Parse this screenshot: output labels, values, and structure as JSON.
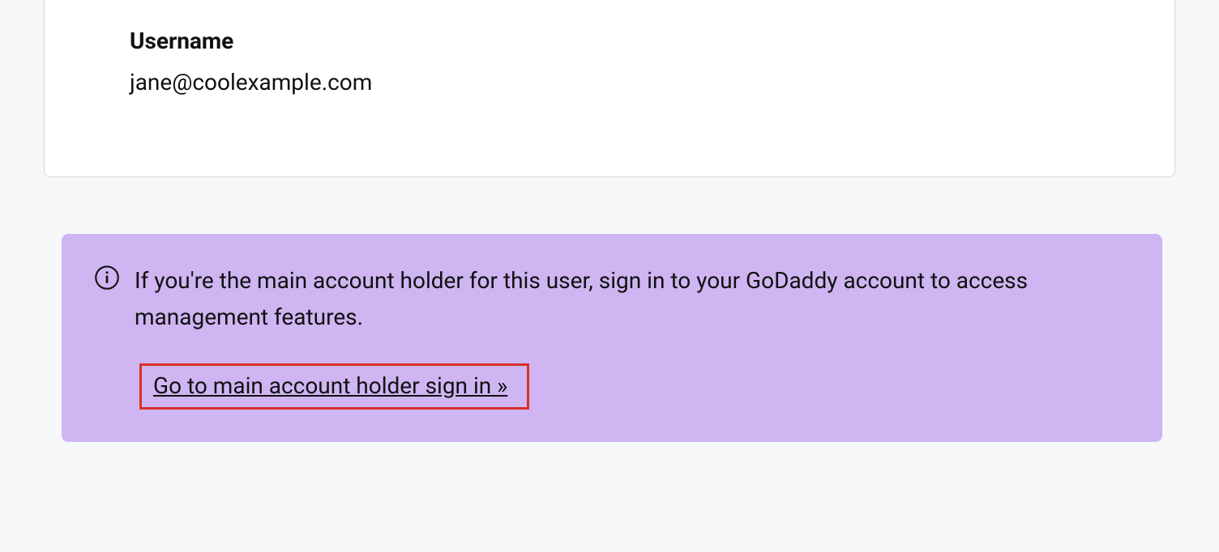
{
  "card": {
    "username_label": "Username",
    "username_value": "jane@coolexample.com"
  },
  "banner": {
    "info_text": "If you're the main account holder for this user, sign in to your GoDaddy account to access management features.",
    "link_text": "Go to main account holder sign in »"
  }
}
